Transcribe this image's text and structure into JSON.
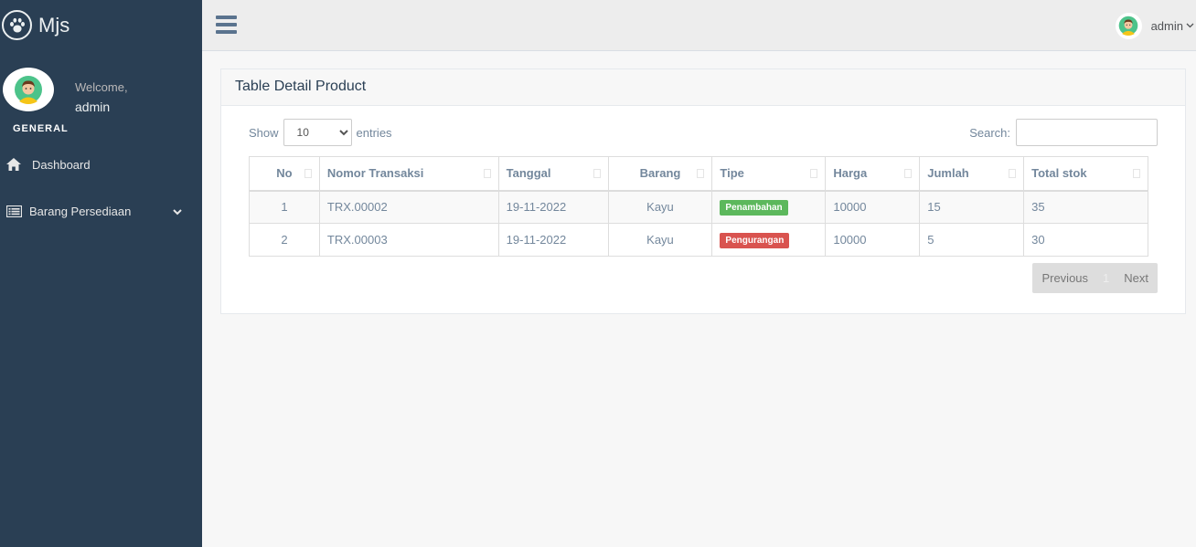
{
  "brand": {
    "name": "Mjs",
    "logo_icon": "paw-icon"
  },
  "profile": {
    "welcome": "Welcome,",
    "name": "admin"
  },
  "sidebar": {
    "section": "GENERAL",
    "items": [
      {
        "label": "Dashboard",
        "icon": "home-icon"
      },
      {
        "label": "Barang Persediaan",
        "icon": "table-list-icon"
      }
    ]
  },
  "topbar": {
    "user": "admin"
  },
  "panel": {
    "title": "Table Detail Product",
    "show_label": "Show",
    "entries_label": "entries",
    "length_value": "10",
    "search_label": "Search:",
    "search_value": ""
  },
  "table": {
    "headers": [
      "No",
      "Nomor Transaksi",
      "Tanggal",
      "Barang",
      "Tipe",
      "Harga",
      "Jumlah",
      "Total stok"
    ],
    "rows": [
      {
        "no": "1",
        "nomor": "TRX.00002",
        "tanggal": "19-11-2022",
        "barang": "Kayu",
        "tipe": "Penambahan",
        "harga": "10000",
        "jumlah": "15",
        "total": "35"
      },
      {
        "no": "2",
        "nomor": "TRX.00003",
        "tanggal": "19-11-2022",
        "barang": "Kayu",
        "tipe": "Pengurangan",
        "harga": "10000",
        "jumlah": "5",
        "total": "30"
      }
    ]
  },
  "pagination": {
    "previous": "Previous",
    "current": "1",
    "next": "Next"
  },
  "colors": {
    "sidebar": "#2A3F54",
    "success": "#5CB85C",
    "danger": "#D9534F"
  }
}
